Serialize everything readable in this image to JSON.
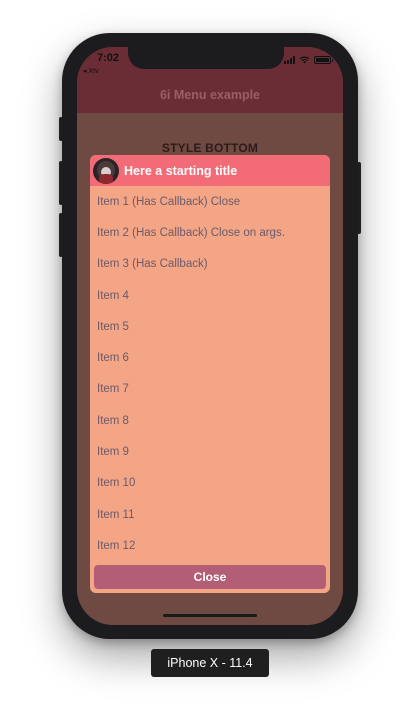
{
  "status_bar": {
    "time": "7:02",
    "back_label": "◂ Xtv"
  },
  "nav": {
    "title": "6i Menu example"
  },
  "page": {
    "section_heading": "STYLE BOTTOM"
  },
  "menu": {
    "title": "Here a starting title",
    "items": [
      {
        "label": "Item 1 (Has Callback) Close"
      },
      {
        "label": "Item 2 (Has Callback) Close on args."
      },
      {
        "label": "Item 3 (Has Callback)"
      },
      {
        "label": "Item 4"
      },
      {
        "label": "Item 5"
      },
      {
        "label": "Item 6"
      },
      {
        "label": "Item 7"
      },
      {
        "label": "Item 8"
      },
      {
        "label": "Item 9"
      },
      {
        "label": "Item 10"
      },
      {
        "label": "Item 11"
      },
      {
        "label": "Item 12"
      }
    ],
    "close_label": "Close"
  },
  "device": {
    "label": "iPhone X - 11.4"
  },
  "colors": {
    "nav_bar": "#6a2d35",
    "page_background": "#6e4a42",
    "menu_header": "#f26b76",
    "menu_body": "#f4a585",
    "close_button": "#b45e76"
  }
}
